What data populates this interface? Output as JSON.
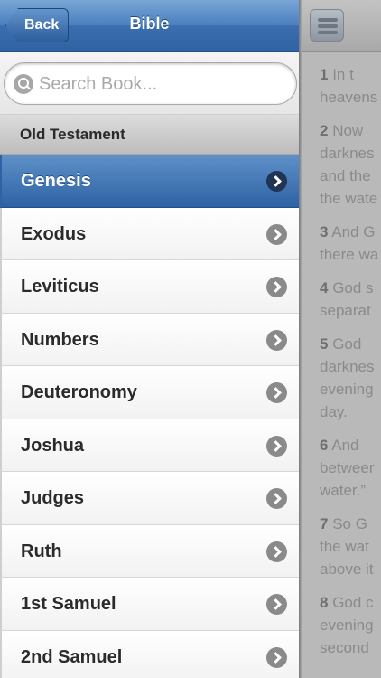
{
  "navbar": {
    "back_label": "Back",
    "title": "Bible"
  },
  "search": {
    "placeholder": "Search Book..."
  },
  "section": {
    "header": "Old Testament"
  },
  "books": [
    {
      "label": "Genesis",
      "selected": true
    },
    {
      "label": "Exodus",
      "selected": false
    },
    {
      "label": "Leviticus",
      "selected": false
    },
    {
      "label": "Numbers",
      "selected": false
    },
    {
      "label": "Deuteronomy",
      "selected": false
    },
    {
      "label": "Joshua",
      "selected": false
    },
    {
      "label": "Judges",
      "selected": false
    },
    {
      "label": "Ruth",
      "selected": false
    },
    {
      "label": "1st Samuel",
      "selected": false
    },
    {
      "label": "2nd Samuel",
      "selected": false
    }
  ],
  "reader": {
    "menu_icon": "hamburger-menu-icon",
    "verses": [
      {
        "num": "1",
        "lines": [
          "In t",
          "heavens"
        ]
      },
      {
        "num": "2",
        "lines": [
          "Now",
          "darknes",
          "and the",
          "the wate"
        ]
      },
      {
        "num": "3",
        "lines": [
          "And G",
          "there wa"
        ]
      },
      {
        "num": "4",
        "lines": [
          "God s",
          "separat"
        ]
      },
      {
        "num": "5",
        "lines": [
          "God",
          "darknes",
          "evening",
          "day."
        ]
      },
      {
        "num": "6",
        "lines": [
          "And",
          "betweer",
          "water.”"
        ]
      },
      {
        "num": "7",
        "lines": [
          "So G",
          "the wat",
          "above it"
        ]
      },
      {
        "num": "8",
        "lines": [
          "God c",
          "evening",
          "second"
        ]
      }
    ]
  },
  "colors": {
    "navbar_blue": "#3a6eae",
    "selected_row": "#2d62a4",
    "reader_overlay": "#b9b9b9"
  }
}
